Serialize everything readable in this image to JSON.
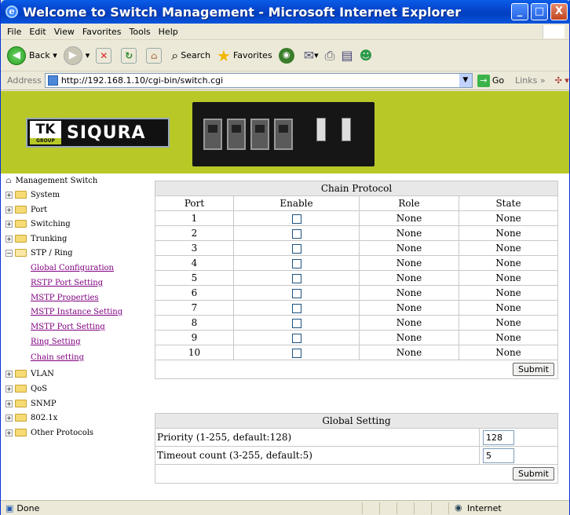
{
  "window": {
    "title": "Welcome to Switch Management - Microsoft Internet Explorer",
    "min": "_",
    "max": "□",
    "close": "X"
  },
  "menu": [
    "File",
    "Edit",
    "View",
    "Favorites",
    "Tools",
    "Help"
  ],
  "toolbar": {
    "back": "Back",
    "search": "Search",
    "favorites": "Favorites"
  },
  "address": {
    "label": "Address",
    "url": "http://192.168.1.10/cgi-bin/switch.cgi",
    "go": "Go",
    "links": "Links"
  },
  "banner": {
    "logo_tk": "TK",
    "logo_group": "GROUP",
    "logo_brand": "SIQURA"
  },
  "sidebar": {
    "root": "Management Switch",
    "items": [
      {
        "label": "System",
        "expanded": false
      },
      {
        "label": "Port",
        "expanded": false
      },
      {
        "label": "Switching",
        "expanded": false
      },
      {
        "label": "Trunking",
        "expanded": false
      },
      {
        "label": "STP / Ring",
        "expanded": true
      }
    ],
    "subitems": [
      "Global Configuration",
      "RSTP Port Setting",
      "MSTP Properties",
      "MSTP Instance Setting",
      "MSTP Port Setting",
      "Ring Setting",
      "Chain setting"
    ],
    "items_after": [
      "VLAN",
      "QoS",
      "SNMP",
      "802.1x",
      "Other Protocols"
    ]
  },
  "chain": {
    "title": "Chain Protocol",
    "columns": [
      "Port",
      "Enable",
      "Role",
      "State"
    ],
    "rows": [
      {
        "port": "1",
        "role": "None",
        "state": "None"
      },
      {
        "port": "2",
        "role": "None",
        "state": "None"
      },
      {
        "port": "3",
        "role": "None",
        "state": "None"
      },
      {
        "port": "4",
        "role": "None",
        "state": "None"
      },
      {
        "port": "5",
        "role": "None",
        "state": "None"
      },
      {
        "port": "6",
        "role": "None",
        "state": "None"
      },
      {
        "port": "7",
        "role": "None",
        "state": "None"
      },
      {
        "port": "8",
        "role": "None",
        "state": "None"
      },
      {
        "port": "9",
        "role": "None",
        "state": "None"
      },
      {
        "port": "10",
        "role": "None",
        "state": "None"
      }
    ],
    "submit": "Submit"
  },
  "global": {
    "title": "Global Setting",
    "priority_label": "Priority (1-255, default:128)",
    "priority_value": "128",
    "timeout_label": "Timeout count (3-255, default:5)",
    "timeout_value": "5",
    "submit": "Submit"
  },
  "status": {
    "left": "Done",
    "zone": "Internet"
  }
}
